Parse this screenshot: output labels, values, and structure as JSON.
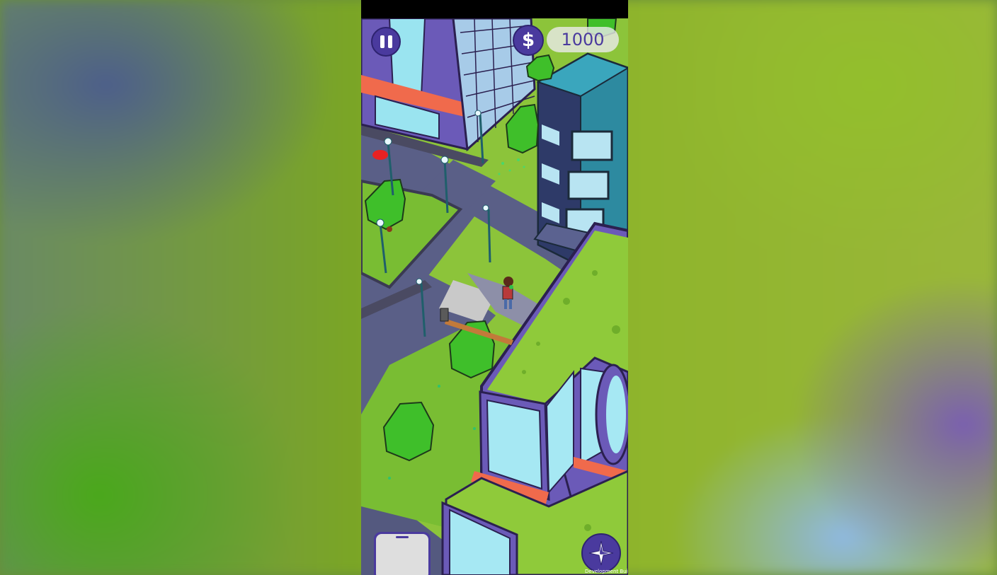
{
  "hud": {
    "pause_icon": "pause-icon",
    "currency_symbol": "$",
    "money": "1000",
    "phone_icon": "phone-icon",
    "map_icon": "compass-icon",
    "dev_label": "Development Build"
  },
  "colors": {
    "hud_purple": "#4a3a9e",
    "road": "#5a5f87",
    "grass": "#8cc43a",
    "building_purple": "#6b5ab8",
    "building_teal": "#2d8aa0",
    "tree": "#3fbf2a"
  }
}
